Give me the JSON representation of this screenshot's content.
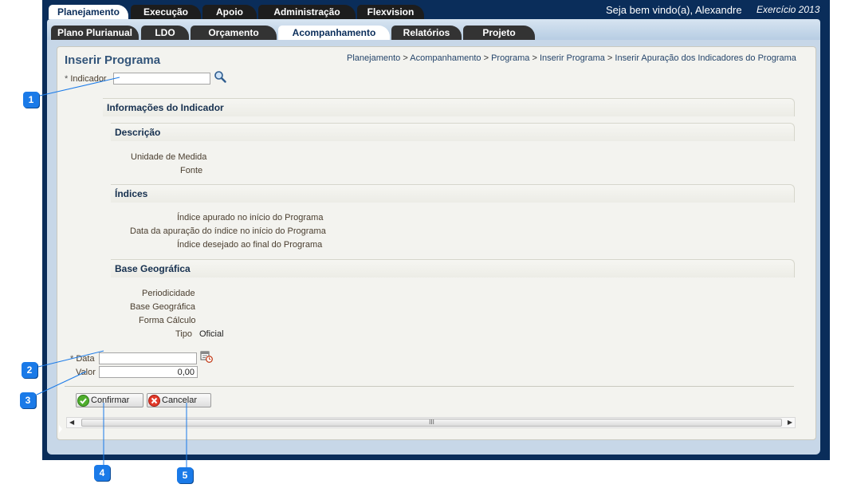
{
  "top_tabs": [
    "Planejamento",
    "Execução",
    "Apoio",
    "Administração",
    "Flexvision"
  ],
  "header": {
    "welcome": "Seja bem vindo(a), Alexandre",
    "exercicio": "Exercício 2013"
  },
  "sub_tabs": [
    "Plano Plurianual",
    "LDO",
    "Orçamento",
    "Acompanhamento",
    "Relatórios",
    "Projeto"
  ],
  "page": {
    "title": "Inserir Programa",
    "breadcrumb": [
      "Planejamento",
      "Acompanhamento",
      "Programa",
      "Inserir Programa",
      "Inserir Apuração dos Indicadores do Programa"
    ],
    "breadcrumb_sep": ">"
  },
  "form": {
    "required_mark": "*",
    "indicador_label": "Indicador",
    "indicador_value": "",
    "info_header": "Informações do Indicador",
    "descricao_header": "Descrição",
    "unidade_label": "Unidade de Medida",
    "fonte_label": "Fonte",
    "indices_header": "Índices",
    "indice_inicio_label": "Índice apurado no início do Programa",
    "data_apuracao_label": "Data da apuração do índice no início do Programa",
    "indice_final_label": "Índice desejado ao final do Programa",
    "base_header": "Base Geográfica",
    "periodicidade_label": "Periodicidade",
    "base_label": "Base Geográfica",
    "forma_label": "Forma Cálculo",
    "tipo_label": "Tipo",
    "tipo_value": "Oficial",
    "data_label": "Data",
    "data_value": "",
    "valor_label": "Valor",
    "valor_value": "0,00"
  },
  "buttons": {
    "confirmar": "Confirmar",
    "cancelar": "Cancelar"
  },
  "scrollbar": {
    "thumb_grip": "III"
  },
  "callouts": [
    "1",
    "2",
    "3",
    "4",
    "5"
  ],
  "colors": {
    "app_bg": "#0a2d5a",
    "callout": "#1a7ae8",
    "panel": "#f3f3ef"
  }
}
